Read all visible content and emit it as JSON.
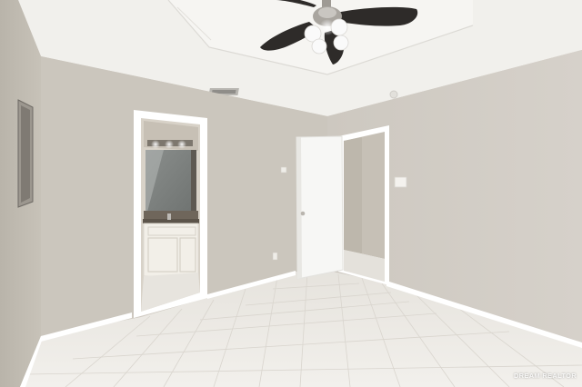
{
  "photo": {
    "subject": "empty-bedroom-interior",
    "watermark": "DREAM REALTOR",
    "colors": {
      "wall_left": "#c4bfb5",
      "wall_back": "#cbc6bd",
      "wall_right": "#cfcac2",
      "ceiling": "#f1f0ec",
      "floor_tile": "#ebe8e3",
      "trim": "#ffffff",
      "fan_blade": "#2e2b29"
    }
  }
}
